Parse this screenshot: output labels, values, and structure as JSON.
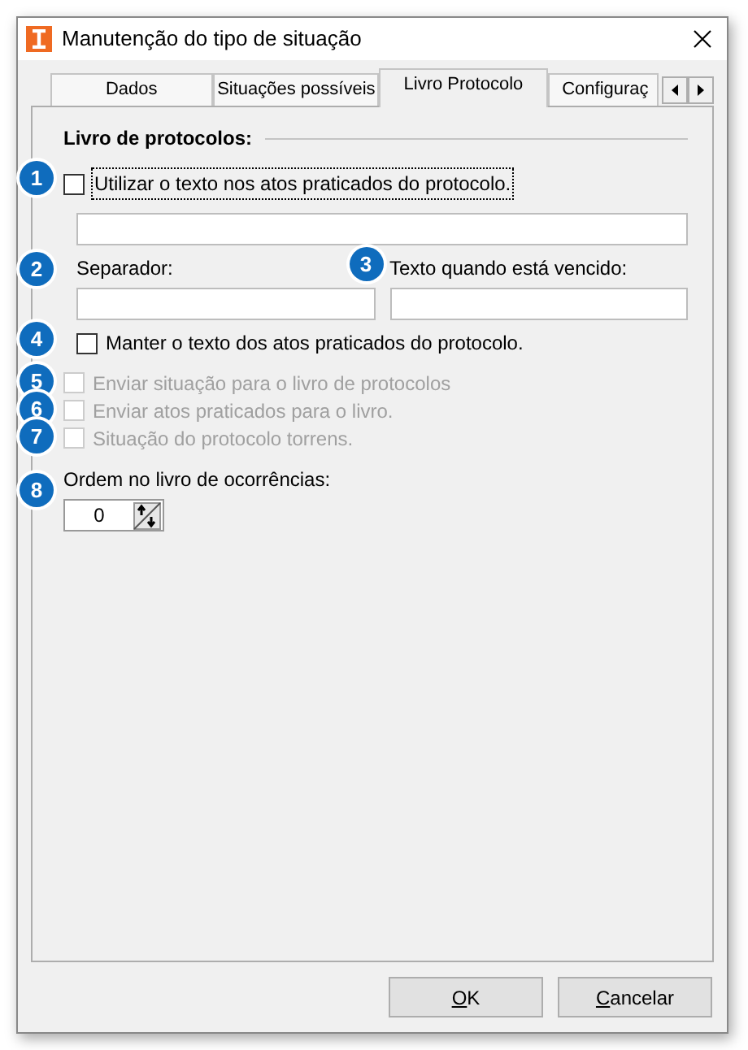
{
  "window": {
    "title": "Manutenção do tipo de situação"
  },
  "tabs": [
    {
      "label": "Dados",
      "selected": false
    },
    {
      "label": "Situações possíveis",
      "selected": false
    },
    {
      "label": "Livro Protocolo",
      "selected": true
    },
    {
      "label": "Configuraç",
      "selected": false
    }
  ],
  "section_title": "Livro de protocolos:",
  "use_text": {
    "marker": "1",
    "label": "Utilizar o texto nos atos praticados do protocolo.",
    "checked": false,
    "focused": true
  },
  "separator": {
    "marker": "2",
    "label": "Separador:"
  },
  "expired_text": {
    "marker": "3",
    "label": "Texto quando está vencido:"
  },
  "keep_text": {
    "marker": "4",
    "label": "Manter o texto dos atos praticados do protocolo.",
    "checked": false
  },
  "options": [
    {
      "marker": "5",
      "label": "Enviar situação para o livro de protocolos",
      "checked": false,
      "disabled": true
    },
    {
      "marker": "6",
      "label": "Enviar atos praticados para o livro.",
      "checked": false,
      "disabled": true
    },
    {
      "marker": "7",
      "label": "Situação do protocolo torrens.",
      "checked": false,
      "disabled": true
    }
  ],
  "order": {
    "marker": "8",
    "label": "Ordem no livro de ocorrências:",
    "value": "0"
  },
  "buttons": [
    {
      "label": "OK"
    },
    {
      "label": "Cancelar"
    }
  ]
}
